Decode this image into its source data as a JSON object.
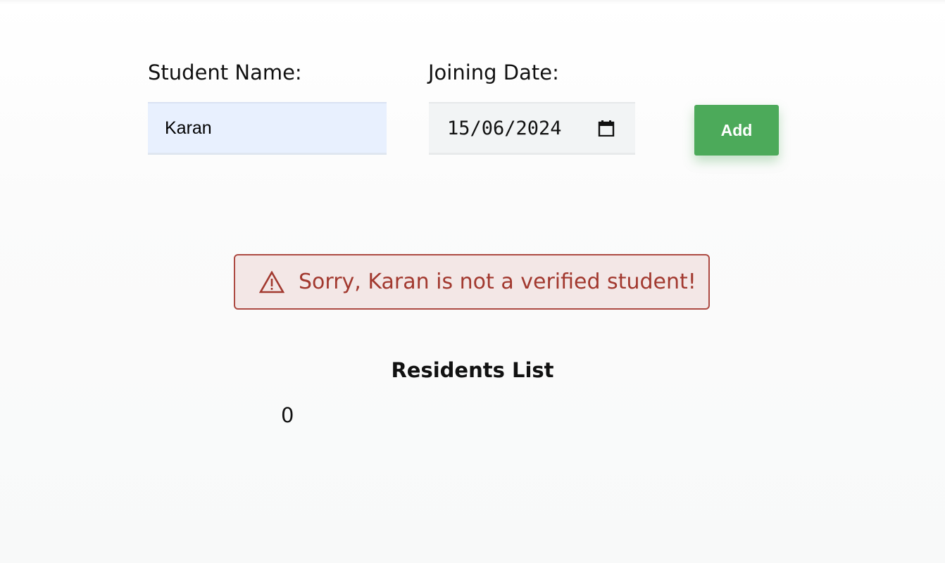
{
  "form": {
    "student_name_label": "Student Name:",
    "student_name_value": "Karan",
    "joining_date_label": "Joining Date:",
    "joining_date_value": "15/06/2024",
    "add_button_label": "Add"
  },
  "alert": {
    "icon": "warning-icon",
    "message": "Sorry, Karan is not a verified student!",
    "color": "#a2392f"
  },
  "residents": {
    "title": "Residents List",
    "count": "0"
  },
  "colors": {
    "add_button": "#4caa5a",
    "name_input_bg": "#e8f0fe",
    "alert_bg": "#f3e7e6"
  }
}
